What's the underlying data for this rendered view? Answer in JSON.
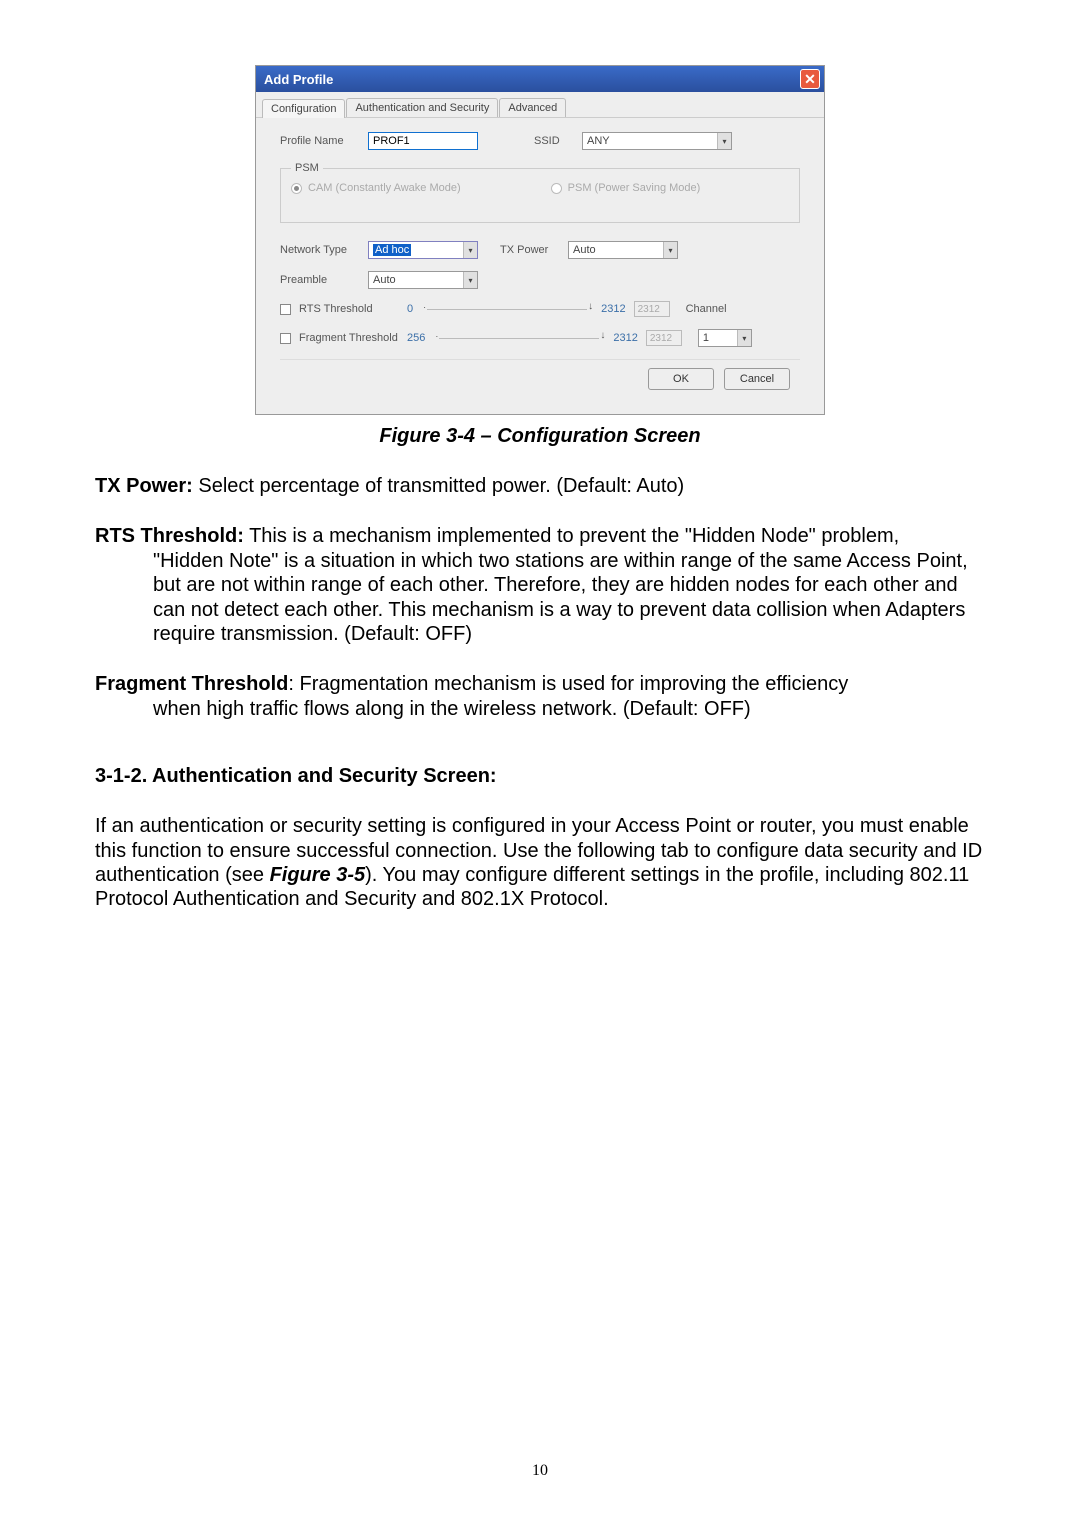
{
  "dialog": {
    "title": "Add Profile",
    "tabs": {
      "configuration": "Configuration",
      "auth": "Authentication and Security",
      "advanced": "Advanced"
    },
    "profile_name_label": "Profile Name",
    "profile_name_value": "PROF1",
    "ssid_label": "SSID",
    "ssid_value": "ANY",
    "psm": {
      "legend": "PSM",
      "cam": "CAM (Constantly Awake Mode)",
      "psm": "PSM (Power Saving Mode)"
    },
    "network_type_label": "Network Type",
    "network_type_value": "Ad hoc",
    "tx_power_label": "TX Power",
    "tx_power_value": "Auto",
    "preamble_label": "Preamble",
    "preamble_value": "Auto",
    "rts": {
      "label": "RTS Threshold",
      "min": "0",
      "max": "2312",
      "box": "2312",
      "channel_label": "Channel"
    },
    "frag": {
      "label": "Fragment Threshold",
      "min": "256",
      "max": "2312",
      "box": "2312",
      "channel_value": "1"
    },
    "ok": "OK",
    "cancel": "Cancel"
  },
  "caption": "Figure 3-4 – Configuration Screen",
  "para1": {
    "term": "TX Power:",
    "text": " Select percentage of transmitted power. (Default: Auto)"
  },
  "para2": {
    "term": "RTS Threshold:",
    "text": " This is a mechanism implemented to prevent the \"Hidden Node\" problem, \"Hidden Note\" is a situation in which two stations are within range of the same Access Point, but are not within range of each other. Therefore, they are hidden nodes for each other and can not detect each other. This mechanism is a way to prevent data collision when Adapters require transmission. (Default: OFF)"
  },
  "para3": {
    "term": "Fragment Threshold",
    "text": ": Fragmentation mechanism is used for improving the efficiency when high traffic flows along in the wireless network. (Default: OFF)"
  },
  "section_head": "3-1-2. Authentication and Security Screen:",
  "body": {
    "pre": "If an authentication or security setting is configured in your Access Point or router, you must enable this function to ensure successful connection. Use the following tab to configure data security and ID authentication (see ",
    "figref": "Figure 3-5",
    "post": "). You may configure different settings in the profile, including 802.11 Protocol Authentication and Security and 802.1X Protocol."
  },
  "pagenum": "10"
}
